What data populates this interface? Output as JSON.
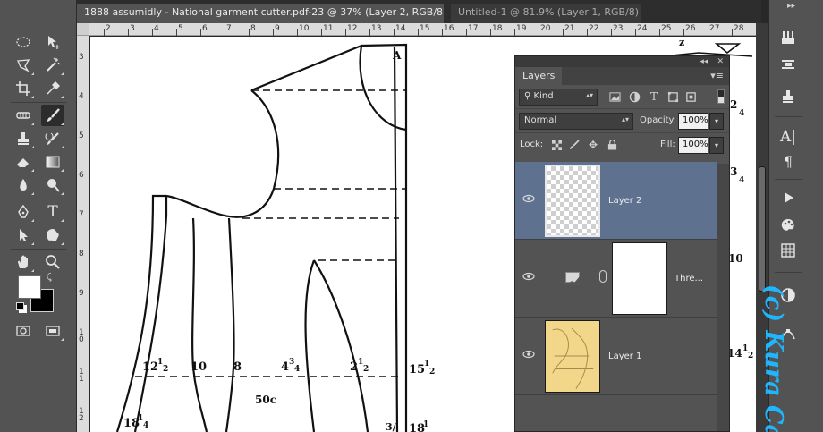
{
  "tabs": [
    {
      "label": "1888 assumidly - National garment cutter.pdf-23 @ 37% (Layer 2, RGB/8) *",
      "close": "×",
      "active": true
    },
    {
      "label": "Untitled-1 @ 81.9% (Layer 1, RGB/8) *",
      "close": "×",
      "active": false
    }
  ],
  "ruler": {
    "h": [
      "2",
      "3",
      "4",
      "5",
      "6",
      "7",
      "8",
      "9",
      "10",
      "11",
      "12",
      "13",
      "14",
      "15",
      "16",
      "17",
      "18",
      "19",
      "20",
      "21",
      "22",
      "23",
      "24",
      "25",
      "26",
      "27",
      "28"
    ],
    "v": [
      "3",
      "4",
      "5",
      "6",
      "7",
      "8",
      "9",
      "1 0",
      "1 1",
      "1 2"
    ]
  },
  "document": {
    "corner_label": "A",
    "labels": {
      "l1": "12",
      "l1s": "1",
      "l1d": "2",
      "l2": "10",
      "l3": "8",
      "l4": "4",
      "l4s": "3",
      "l4d": "4",
      "l5": "2",
      "l5s": "1",
      "l5d": "2",
      "l6": "15",
      "l6s": "1",
      "l6d": "2",
      "l7": "50c",
      "l8": "18",
      "l8s": "1",
      "l8d": "4",
      "r1": "2",
      "r1d": "4",
      "r2": "3",
      "r2d": "4",
      "r3": "10",
      "r4": "14",
      "r4s": "1",
      "r4d": "2",
      "top_z": "z",
      "bot1": "3/",
      "bot2": "18",
      "bot2s": "1"
    }
  },
  "layers_panel": {
    "title": "Layers",
    "menu": "▾≡",
    "top_controls": [
      "◂◂",
      "✕"
    ],
    "filter": {
      "label": "Kind"
    },
    "blend_mode": "Normal",
    "opacity_label": "Opacity:",
    "opacity_value": "100%",
    "lock_label": "Lock:",
    "fill_label": "Fill:",
    "fill_value": "100%",
    "layers": [
      {
        "name": "Layer 2",
        "selected": true
      },
      {
        "name": "Thre...",
        "selected": false
      },
      {
        "name": "Layer 1",
        "selected": false
      }
    ]
  },
  "watermark": "(c) Kura Ca",
  "colors": {
    "selected_layer": "#5e7290",
    "watermark": "#1fb6ff",
    "toolbar": "#535353"
  }
}
